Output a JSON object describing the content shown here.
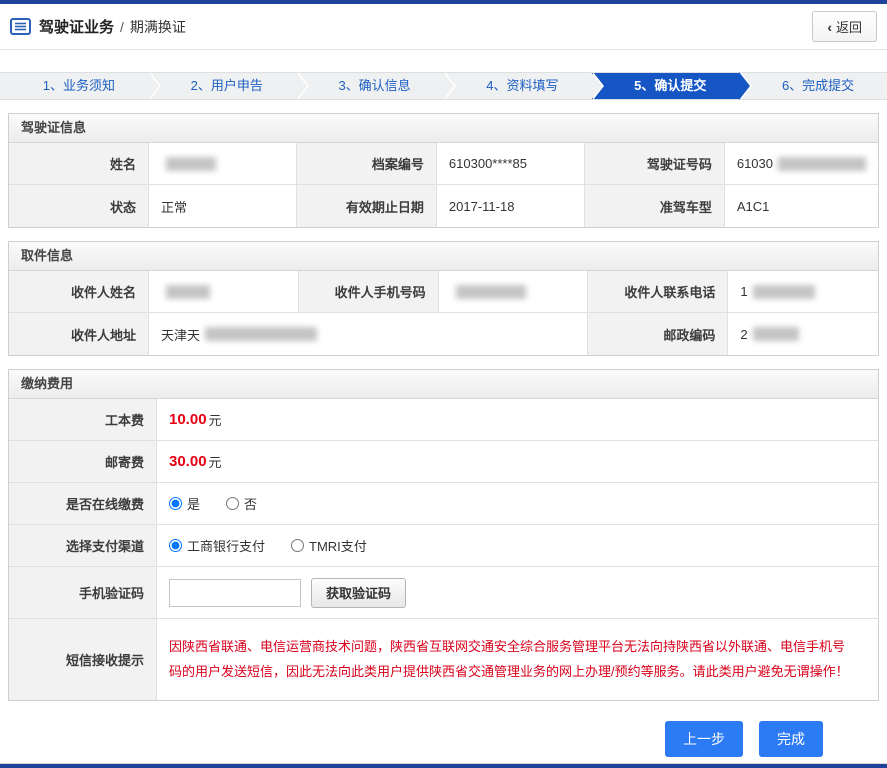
{
  "page": {
    "title": "驾驶证业务",
    "sep": "/",
    "subtitle": "期满换证",
    "back_chevron": "‹",
    "back_label": "返回"
  },
  "steps": [
    {
      "label": "1、业务须知"
    },
    {
      "label": "2、用户申告"
    },
    {
      "label": "3、确认信息"
    },
    {
      "label": "4、资料填写"
    },
    {
      "label": "5、确认提交"
    },
    {
      "label": "6、完成提交"
    }
  ],
  "license": {
    "title": "驾驶证信息",
    "rows": [
      [
        {
          "label": "姓名",
          "value": ""
        },
        {
          "label": "档案编号",
          "value": "610300****85"
        },
        {
          "label": "驾驶证号码",
          "value": "61030"
        }
      ],
      [
        {
          "label": "状态",
          "value": "正常"
        },
        {
          "label": "有效期止日期",
          "value": "2017-11-18"
        },
        {
          "label": "准驾车型",
          "value": "A1C1"
        }
      ]
    ]
  },
  "pickup": {
    "title": "取件信息",
    "row1": [
      {
        "label": "收件人姓名",
        "value": ""
      },
      {
        "label": "收件人手机号码",
        "value": ""
      },
      {
        "label": "收件人联系电话",
        "value": "1"
      }
    ],
    "row2": {
      "address_label": "收件人地址",
      "address_value": "天津天",
      "postal_label": "邮政编码",
      "postal_value": "2"
    }
  },
  "fees": {
    "title": "缴纳费用",
    "cost_label": "工本费",
    "cost_value": "10.00",
    "cost_unit": "元",
    "postage_label": "邮寄费",
    "postage_value": "30.00",
    "postage_unit": "元",
    "online_label": "是否在线缴费",
    "online_options": [
      "是",
      "否"
    ],
    "channel_label": "选择支付渠道",
    "channel_options": [
      "工商银行支付",
      "TMRI支付"
    ],
    "sms_label": "手机验证码",
    "sms_button": "获取验证码",
    "notice_label": "短信接收提示",
    "notice_text": "因陕西省联通、电信运营商技术问题，陕西省互联网交通安全综合服务管理平台无法向持陕西省以外联通、电信手机号码的用户发送短信，因此无法向此类用户提供陕西省交通管理业务的网上办理/预约等服务。请此类用户避免无谓操作！"
  },
  "footer": {
    "prev_label": "上一步",
    "done_label": "完成"
  },
  "colors": {
    "brand_bar_blue": "#20409a",
    "active_step_blue": "#1556c4",
    "link_blue": "#1d5fc2",
    "button_blue": "#2d7bf4",
    "warning_red": "#d9001b",
    "amount_red": "#e60012"
  }
}
